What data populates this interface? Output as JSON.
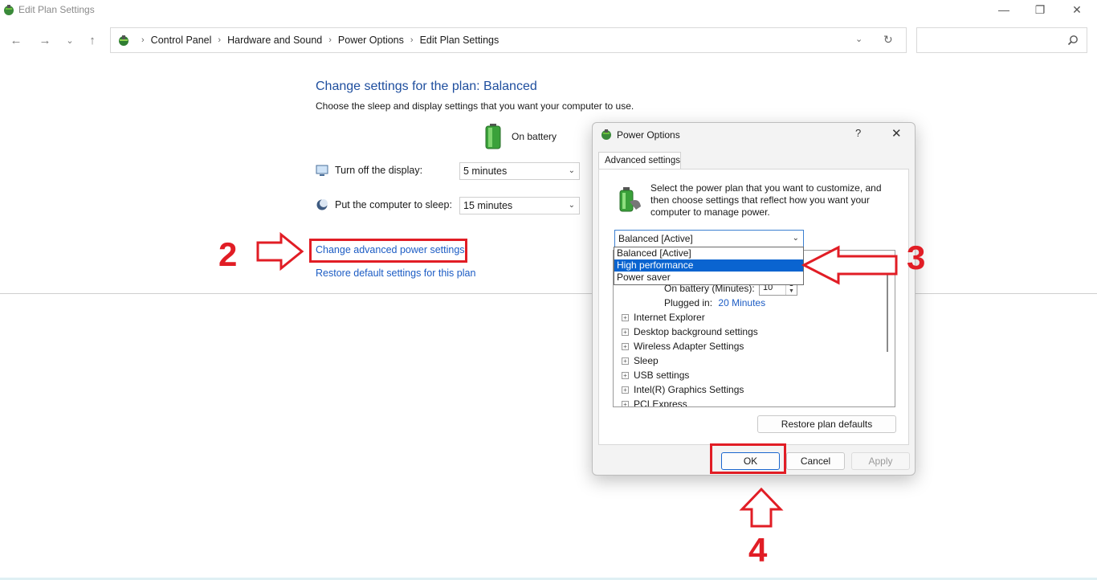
{
  "window": {
    "title": "Edit Plan Settings",
    "controls": {
      "minimize": "—",
      "maximize": "❐",
      "close": "✕"
    }
  },
  "nav": {
    "back": "←",
    "forward": "→",
    "recent": "⌄",
    "up": "↑",
    "breadcrumb": [
      "Control Panel",
      "Hardware and Sound",
      "Power Options",
      "Edit Plan Settings"
    ],
    "breadcrumb_sep": "›",
    "dropdown": "⌄",
    "refresh": "↻",
    "search_placeholder": ""
  },
  "main": {
    "heading": "Change settings for the plan: Balanced",
    "subheading": "Choose the sleep and display settings that you want your computer to use.",
    "column_label": "On battery",
    "display_label": "Turn off the display:",
    "display_value": "5 minutes",
    "sleep_label": "Put the computer to sleep:",
    "sleep_value": "15 minutes",
    "advanced_link": "Change advanced power settings",
    "restore_link": "Restore default settings for this plan"
  },
  "annotations": {
    "step2": "2",
    "step3": "3",
    "step4": "4",
    "accent": "#e11d25"
  },
  "dialog": {
    "title": "Power Options",
    "help": "?",
    "close": "✕",
    "tab": "Advanced settings",
    "description": "Select the power plan that you want to customize, and then choose settings that reflect how you want your computer to manage power.",
    "plan_selected": "Balanced [Active]",
    "plan_options": [
      "Balanced [Active]",
      "High performance",
      "Power saver"
    ],
    "highlighted_option": "High performance",
    "tree": {
      "on_battery_label": "On battery (Minutes):",
      "on_battery_value": "10",
      "plugged_label": "Plugged in:",
      "plugged_value": "20 Minutes",
      "items": [
        "Internet Explorer",
        "Desktop background settings",
        "Wireless Adapter Settings",
        "Sleep",
        "USB settings",
        "Intel(R) Graphics Settings",
        "PCI Express"
      ]
    },
    "restore_button": "Restore plan defaults",
    "ok": "OK",
    "cancel": "Cancel",
    "apply": "Apply"
  }
}
